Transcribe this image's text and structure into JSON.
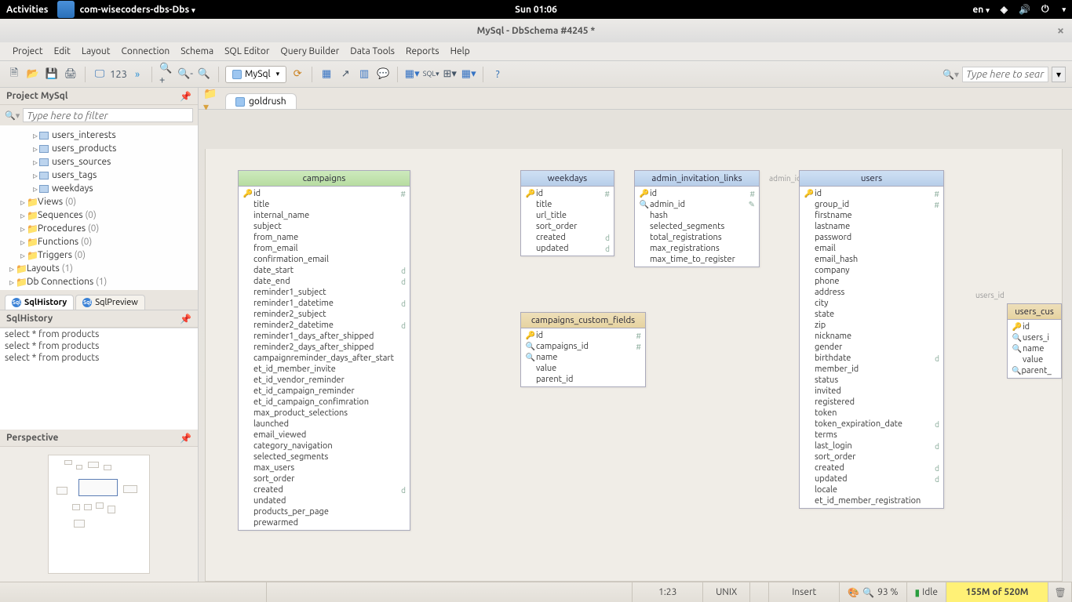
{
  "sysbar": {
    "activities": "Activities",
    "app_label": "com-wisecoders-dbs-Dbs",
    "clock": "Sun 01:06",
    "lang": "en"
  },
  "titlebar": {
    "title": "MySql - DbSchema #4245 *"
  },
  "menu": [
    "Project",
    "Edit",
    "Layout",
    "Connection",
    "Schema",
    "SQL Editor",
    "Query Builder",
    "Data Tools",
    "Reports",
    "Help"
  ],
  "db_selector": {
    "label": "MySql"
  },
  "searchbox": {
    "placeholder": "Type here to sear"
  },
  "left": {
    "project_title": "Project MySql",
    "filter_placeholder": "Type here to filter",
    "tree_leaves": [
      "users_interests",
      "users_products",
      "users_sources",
      "users_tags",
      "weekdays"
    ],
    "tree_folders": [
      {
        "label": "Views",
        "count": "(0)"
      },
      {
        "label": "Sequences",
        "count": "(0)"
      },
      {
        "label": "Procedures",
        "count": "(0)"
      },
      {
        "label": "Functions",
        "count": "(0)"
      },
      {
        "label": "Triggers",
        "count": "(0)"
      }
    ],
    "tree_root": [
      {
        "label": "Layouts",
        "count": "(1)"
      },
      {
        "label": "Db Connections",
        "count": "(1)"
      }
    ],
    "tabs": [
      {
        "label": "SqlHistory",
        "active": true
      },
      {
        "label": "SqlPreview",
        "active": false
      }
    ],
    "history_title": "SqlHistory",
    "history": [
      "select * from products",
      "select * from products",
      "select * from products"
    ],
    "perspective_title": "Perspective"
  },
  "canvas": {
    "tab": "goldrush",
    "relations": {
      "admin_id": "admin_id",
      "users_id": "users_id"
    },
    "tables": {
      "campaigns": {
        "title": "campaigns",
        "cols": [
          {
            "k": "🔑",
            "n": "id",
            "t": "#"
          },
          {
            "k": "",
            "n": "title",
            "t": ""
          },
          {
            "k": "",
            "n": "internal_name",
            "t": ""
          },
          {
            "k": "",
            "n": "subject",
            "t": ""
          },
          {
            "k": "",
            "n": "from_name",
            "t": ""
          },
          {
            "k": "",
            "n": "from_email",
            "t": ""
          },
          {
            "k": "",
            "n": "confirmation_email",
            "t": ""
          },
          {
            "k": "",
            "n": "date_start",
            "t": "d"
          },
          {
            "k": "",
            "n": "date_end",
            "t": "d"
          },
          {
            "k": "",
            "n": "reminder1_subject",
            "t": ""
          },
          {
            "k": "",
            "n": "reminder1_datetime",
            "t": "d"
          },
          {
            "k": "",
            "n": "reminder2_subject",
            "t": ""
          },
          {
            "k": "",
            "n": "reminder2_datetime",
            "t": "d"
          },
          {
            "k": "",
            "n": "reminder1_days_after_shipped",
            "t": ""
          },
          {
            "k": "",
            "n": "reminder2_days_after_shipped",
            "t": ""
          },
          {
            "k": "",
            "n": "campaignreminder_days_after_start",
            "t": ""
          },
          {
            "k": "",
            "n": "et_id_member_invite",
            "t": ""
          },
          {
            "k": "",
            "n": "et_id_vendor_reminder",
            "t": ""
          },
          {
            "k": "",
            "n": "et_id_campaign_reminder",
            "t": ""
          },
          {
            "k": "",
            "n": "et_id_campaign_confimration",
            "t": ""
          },
          {
            "k": "",
            "n": "max_product_selections",
            "t": ""
          },
          {
            "k": "",
            "n": "launched",
            "t": ""
          },
          {
            "k": "",
            "n": "email_viewed",
            "t": ""
          },
          {
            "k": "",
            "n": "category_navigation",
            "t": ""
          },
          {
            "k": "",
            "n": "selected_segments",
            "t": ""
          },
          {
            "k": "",
            "n": "max_users",
            "t": ""
          },
          {
            "k": "",
            "n": "sort_order",
            "t": ""
          },
          {
            "k": "",
            "n": "created",
            "t": "d"
          },
          {
            "k": "",
            "n": "undated",
            "t": ""
          },
          {
            "k": "",
            "n": "products_per_page",
            "t": ""
          },
          {
            "k": "",
            "n": "prewarmed",
            "t": ""
          }
        ]
      },
      "weekdays": {
        "title": "weekdays",
        "cols": [
          {
            "k": "🔑",
            "n": "id",
            "t": "#"
          },
          {
            "k": "",
            "n": "title",
            "t": ""
          },
          {
            "k": "",
            "n": "url_title",
            "t": ""
          },
          {
            "k": "",
            "n": "sort_order",
            "t": ""
          },
          {
            "k": "",
            "n": "created",
            "t": "d"
          },
          {
            "k": "",
            "n": "updated",
            "t": "d"
          }
        ]
      },
      "admin_invitation_links": {
        "title": "admin_invitation_links",
        "cols": [
          {
            "k": "🔑",
            "n": "id",
            "t": "#"
          },
          {
            "k": "🔍",
            "n": "admin_id",
            "t": "✎"
          },
          {
            "k": "",
            "n": "hash",
            "t": ""
          },
          {
            "k": "",
            "n": "selected_segments",
            "t": ""
          },
          {
            "k": "",
            "n": "total_registrations",
            "t": ""
          },
          {
            "k": "",
            "n": "max_registrations",
            "t": ""
          },
          {
            "k": "",
            "n": "max_time_to_register",
            "t": ""
          }
        ]
      },
      "users": {
        "title": "users",
        "cols": [
          {
            "k": "🔑",
            "n": "id",
            "t": "#"
          },
          {
            "k": "",
            "n": "group_id",
            "t": "#"
          },
          {
            "k": "",
            "n": "firstname",
            "t": ""
          },
          {
            "k": "",
            "n": "lastname",
            "t": ""
          },
          {
            "k": "",
            "n": "password",
            "t": ""
          },
          {
            "k": "",
            "n": "email",
            "t": ""
          },
          {
            "k": "",
            "n": "email_hash",
            "t": ""
          },
          {
            "k": "",
            "n": "company",
            "t": ""
          },
          {
            "k": "",
            "n": "phone",
            "t": ""
          },
          {
            "k": "",
            "n": "address",
            "t": ""
          },
          {
            "k": "",
            "n": "city",
            "t": ""
          },
          {
            "k": "",
            "n": "state",
            "t": ""
          },
          {
            "k": "",
            "n": "zip",
            "t": ""
          },
          {
            "k": "",
            "n": "nickname",
            "t": ""
          },
          {
            "k": "",
            "n": "gender",
            "t": ""
          },
          {
            "k": "",
            "n": "birthdate",
            "t": "d"
          },
          {
            "k": "",
            "n": "member_id",
            "t": ""
          },
          {
            "k": "",
            "n": "status",
            "t": ""
          },
          {
            "k": "",
            "n": "invited",
            "t": ""
          },
          {
            "k": "",
            "n": "registered",
            "t": ""
          },
          {
            "k": "",
            "n": "token",
            "t": ""
          },
          {
            "k": "",
            "n": "token_expiration_date",
            "t": "d"
          },
          {
            "k": "",
            "n": "terms",
            "t": ""
          },
          {
            "k": "",
            "n": "last_login",
            "t": "d"
          },
          {
            "k": "",
            "n": "sort_order",
            "t": ""
          },
          {
            "k": "",
            "n": "created",
            "t": "d"
          },
          {
            "k": "",
            "n": "updated",
            "t": "d"
          },
          {
            "k": "",
            "n": "locale",
            "t": ""
          },
          {
            "k": "",
            "n": "et_id_member_registration",
            "t": ""
          }
        ]
      },
      "campaigns_custom_fields": {
        "title": "campaigns_custom_fields",
        "cols": [
          {
            "k": "🔑",
            "n": "id",
            "t": "#"
          },
          {
            "k": "🔍",
            "n": "campaigns_id",
            "t": "#"
          },
          {
            "k": "🔍",
            "n": "name",
            "t": ""
          },
          {
            "k": "",
            "n": "value",
            "t": ""
          },
          {
            "k": "",
            "n": "parent_id",
            "t": ""
          }
        ]
      },
      "users_cust": {
        "title": "users_cus",
        "cols": [
          {
            "k": "🔑",
            "n": "id",
            "t": ""
          },
          {
            "k": "🔍",
            "n": "users_i",
            "t": ""
          },
          {
            "k": "🔍",
            "n": "name",
            "t": ""
          },
          {
            "k": "",
            "n": "value",
            "t": ""
          },
          {
            "k": "🔍",
            "n": "parent_",
            "t": ""
          }
        ]
      }
    }
  },
  "status": {
    "pos": "1:23",
    "eol": "UNIX",
    "mode": "Insert",
    "zoom": "93 %",
    "idle": "Idle",
    "mem": "155M of 520M"
  }
}
